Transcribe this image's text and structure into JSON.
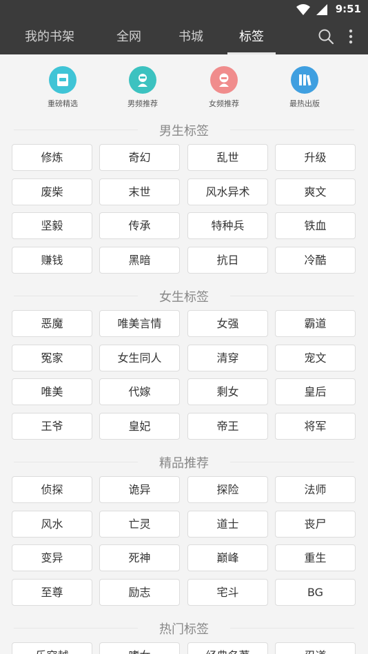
{
  "status_bar": {
    "time": "9:51"
  },
  "tabs": [
    {
      "label": "我的书架",
      "active": false
    },
    {
      "label": "全网",
      "active": false
    },
    {
      "label": "书城",
      "active": false
    },
    {
      "label": "标签",
      "active": true
    }
  ],
  "quick_links": [
    {
      "label": "重磅精选",
      "icon": "featured-book-icon",
      "color": "#3fc4d6"
    },
    {
      "label": "男频推荐",
      "icon": "male-reader-icon",
      "color": "#3cc2c0"
    },
    {
      "label": "女频推荐",
      "icon": "female-reader-icon",
      "color": "#f08c8c"
    },
    {
      "label": "最热出版",
      "icon": "books-icon",
      "color": "#3f9fe0"
    }
  ],
  "sections": [
    {
      "title": "男生标签",
      "tags": [
        "修炼",
        "奇幻",
        "乱世",
        "升级",
        "废柴",
        "末世",
        "风水异术",
        "爽文",
        "坚毅",
        "传承",
        "特种兵",
        "铁血",
        "赚钱",
        "黑暗",
        "抗日",
        "冷酷"
      ]
    },
    {
      "title": "女生标签",
      "tags": [
        "恶魔",
        "唯美言情",
        "女强",
        "霸道",
        "冤家",
        "女生同人",
        "清穿",
        "宠文",
        "唯美",
        "代嫁",
        "剩女",
        "皇后",
        "王爷",
        "皇妃",
        "帝王",
        "将军"
      ]
    },
    {
      "title": "精品推荐",
      "tags": [
        "侦探",
        "诡异",
        "探险",
        "法师",
        "风水",
        "亡灵",
        "道士",
        "丧尸",
        "变异",
        "死神",
        "巅峰",
        "重生",
        "至尊",
        "励志",
        "宅斗",
        "BG"
      ]
    },
    {
      "title": "热门标签",
      "tags": [
        "乐穿越",
        "嗜女",
        "经典名著",
        "忍道"
      ]
    }
  ]
}
